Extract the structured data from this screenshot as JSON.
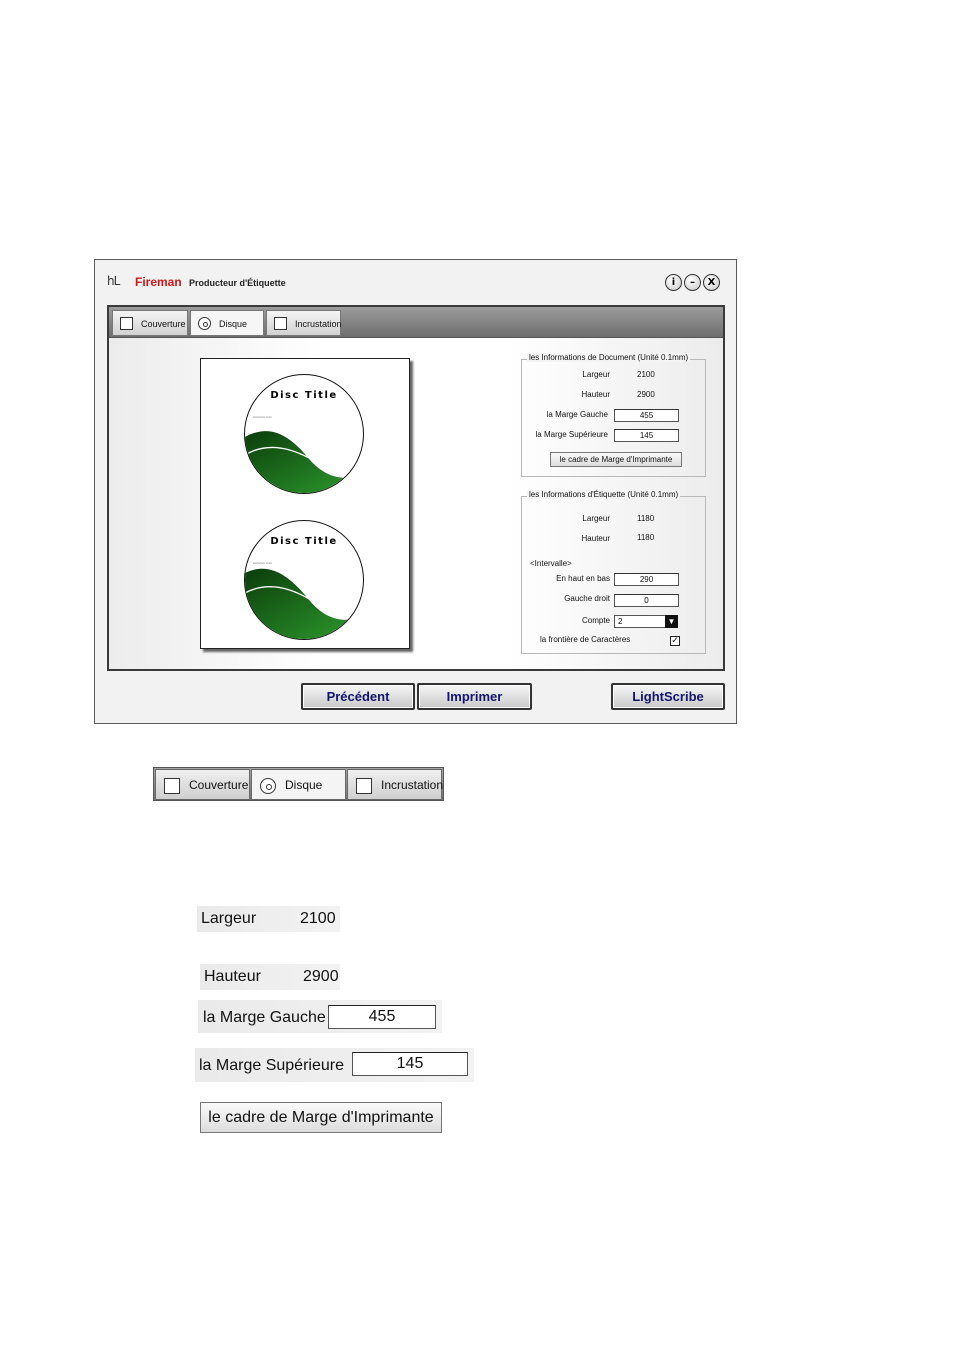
{
  "window": {
    "logo": "hL",
    "app_name": "Fireman",
    "app_subtitle": "Producteur d'Étiquette",
    "info_btn": "i",
    "minimize_btn": "–",
    "close_btn": "X"
  },
  "tabs": [
    {
      "label": "Couverture",
      "icon": "checkbox-icon",
      "active": false
    },
    {
      "label": "Disque",
      "icon": "disc-icon",
      "active": true
    },
    {
      "label": "Incrustation",
      "icon": "checkbox-icon",
      "active": false
    }
  ],
  "preview": {
    "discs": [
      {
        "title": "Disc Title",
        "subtitle": "xxxxxxxx xxxx"
      },
      {
        "title": "Disc Title",
        "subtitle": "xxxxxxxx xxxx"
      }
    ],
    "colors": {
      "wave_dark": "#0b3d0b",
      "wave_light": "#2e9e2e"
    }
  },
  "doc_info": {
    "legend": "les Informations de Document (Unité 0.1mm)",
    "width_label": "Largeur",
    "width_value": "2100",
    "height_label": "Hauteur",
    "height_value": "2900",
    "left_margin_label": "la Marge Gauche",
    "left_margin_value": "455",
    "top_margin_label": "la Marge Supérieure",
    "top_margin_value": "145",
    "printer_margin_btn": "le cadre de Marge d'Imprimante"
  },
  "label_info": {
    "legend": "les Informations d'Étiquette (Unité 0.1mm)",
    "width_label": "Largeur",
    "width_value": "1180",
    "height_label": "Hauteur",
    "height_value": "1180",
    "interval_label": "<Intervalle>",
    "top_bottom_label": "En haut en bas",
    "top_bottom_value": "290",
    "left_right_label": "Gauche droit",
    "left_right_value": "0",
    "count_label": "Compte",
    "count_value": "2",
    "border_label": "la frontière de Caractères",
    "border_checked": true
  },
  "buttons": {
    "previous": "Précédent",
    "print": "Imprimer",
    "lightscribe": "LightScribe"
  },
  "zoom": {
    "tabs": [
      "Couverture",
      "Disque",
      "Incrustation"
    ],
    "width_label": "Largeur",
    "width_value": "2100",
    "height_label": "Hauteur",
    "height_value": "2900",
    "left_margin_label": "la Marge Gauche",
    "left_margin_value": "455",
    "top_margin_label": "la Marge Supérieure",
    "top_margin_value": "145",
    "printer_margin_btn": "le cadre de Marge d'Imprimante"
  }
}
